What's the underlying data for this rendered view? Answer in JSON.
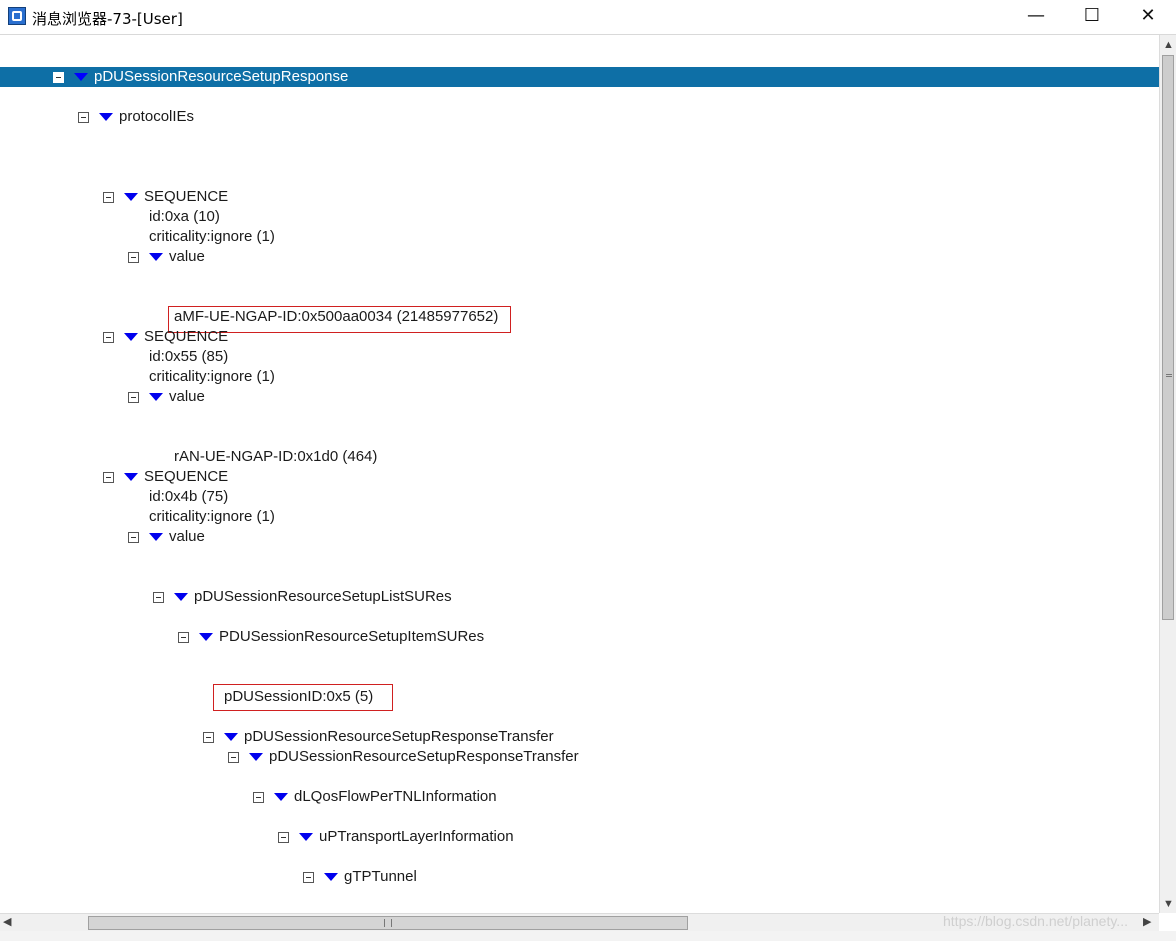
{
  "window": {
    "title": "消息浏览器-73-[User]",
    "minimize": "—",
    "maximize": "☐",
    "close": "✕"
  },
  "tree": [
    "pDUSessionResourceSetupResponse",
    "protocolIEs",
    "SEQUENCE",
    "id:0xa (10)",
    "criticality:ignore (1)",
    "value",
    "aMF-UE-NGAP-ID:0x500aa0034 (21485977652)",
    "SEQUENCE",
    "id:0x55 (85)",
    "criticality:ignore (1)",
    "value",
    "rAN-UE-NGAP-ID:0x1d0 (464)",
    "SEQUENCE",
    "id:0x4b (75)",
    "criticality:ignore (1)",
    "value",
    "pDUSessionResourceSetupListSURes",
    "PDUSessionResourceSetupItemSURes",
    "pDUSessionID:0x5 (5)",
    "pDUSessionResourceSetupResponseTransfer",
    "pDUSessionResourceSetupResponseTransfer",
    "dLQosFlowPerTNLInformation",
    "uPTransportLayerInformation",
    "gTPTunnel"
  ],
  "watermark": "https://blog.csdn.net/planety..."
}
